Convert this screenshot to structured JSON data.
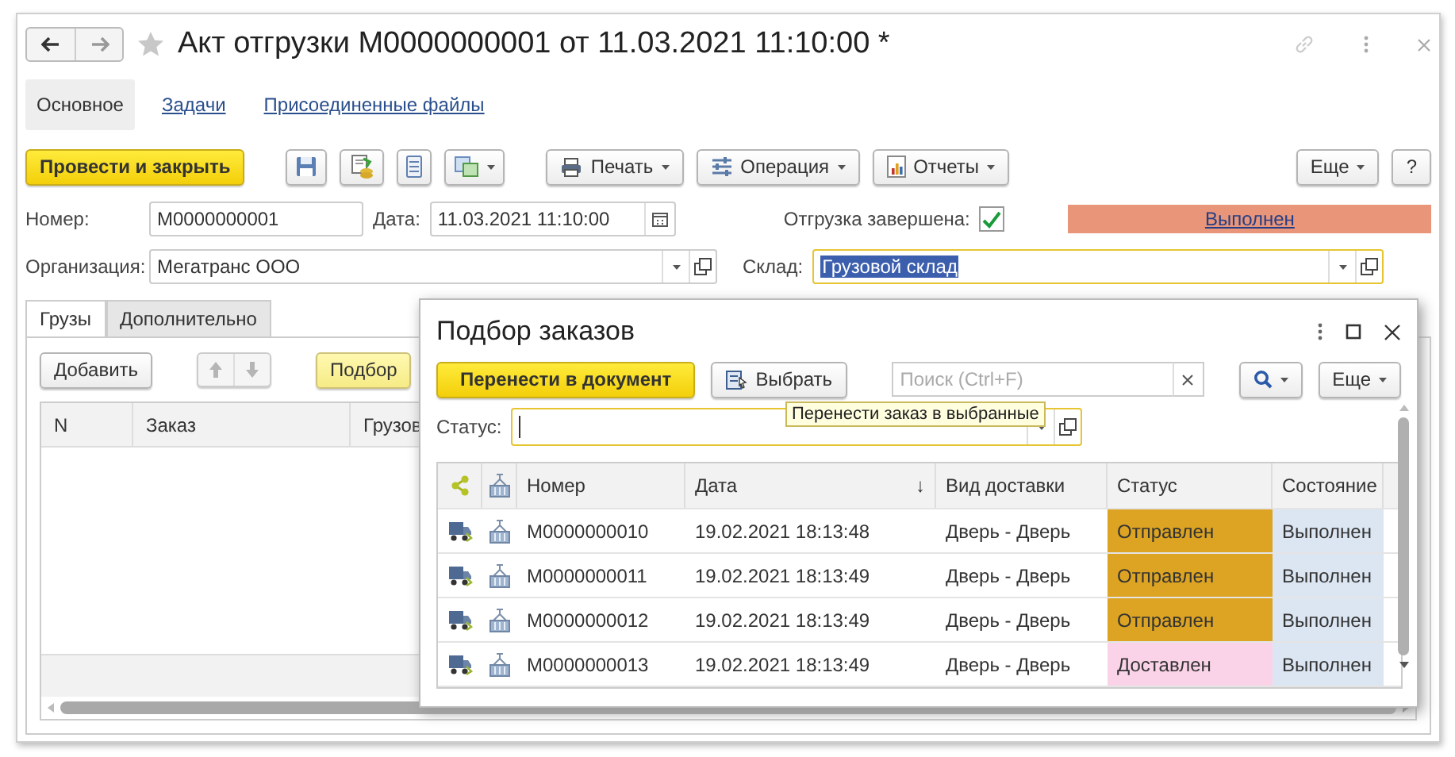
{
  "window": {
    "title": "Акт отгрузки М0000000001 от 11.03.2021 11:10:00 *"
  },
  "sections": [
    {
      "label": "Основное",
      "selected": true
    },
    {
      "label": "Задачи",
      "selected": false
    },
    {
      "label": "Присоединенные файлы",
      "selected": false
    }
  ],
  "toolbar": {
    "primary": "Провести и закрыть",
    "print": "Печать",
    "operation": "Операция",
    "reports": "Отчеты",
    "more": "Еще",
    "help": "?"
  },
  "form": {
    "number_label": "Номер:",
    "number": "М0000000001",
    "date_label": "Дата:",
    "date": "11.03.2021 11:10:00",
    "org_label": "Организация:",
    "org": "Мегатранс ООО",
    "shipment_done": {
      "label": "Отгрузка завершена:",
      "checked": true
    },
    "state_link": "Выполнен",
    "warehouse_label": "Склад:",
    "warehouse": "Грузовой склад"
  },
  "inner_tabs": [
    {
      "label": "Грузы",
      "selected": true
    },
    {
      "label": "Дополнительно",
      "selected": false
    }
  ],
  "cargo_toolbar": {
    "add": "Добавить",
    "pick": "Подбор"
  },
  "cargo_table": {
    "columns": [
      "N",
      "Заказ",
      "Грузов"
    ]
  },
  "dialog": {
    "title": "Подбор заказов",
    "transfer": "Перенести в документ",
    "select": "Выбрать",
    "search_placeholder": "Поиск (Ctrl+F)",
    "more": "Еще",
    "tooltip": "Перенести заказ в выбранные",
    "status_label": "Статус:",
    "columns": [
      "Номер",
      "Дата",
      "Вид доставки",
      "Статус",
      "Состояние"
    ],
    "sort_mark": "↓",
    "rows": [
      {
        "number": "М0000000010",
        "date": "19.02.2021 18:13:48",
        "delivery": "Дверь - Дверь",
        "status": "Отправлен",
        "color": "#dca422",
        "state": "Выполнен"
      },
      {
        "number": "М0000000011",
        "date": "19.02.2021 18:13:49",
        "delivery": "Дверь - Дверь",
        "status": "Отправлен",
        "color": "#dca422",
        "state": "Выполнен"
      },
      {
        "number": "М0000000012",
        "date": "19.02.2021 18:13:49",
        "delivery": "Дверь - Дверь",
        "status": "Отправлен",
        "color": "#dca422",
        "state": "Выполнен"
      },
      {
        "number": "М0000000013",
        "date": "19.02.2021 18:13:49",
        "delivery": "Дверь - Дверь",
        "status": "Доставлен",
        "color": "#fbd3e8",
        "state": "Выполнен"
      }
    ]
  }
}
